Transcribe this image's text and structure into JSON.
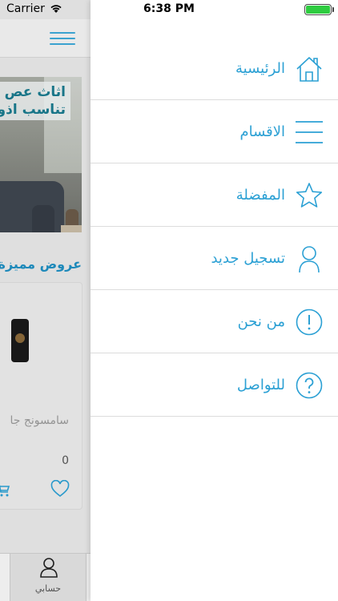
{
  "status_bar": {
    "carrier": "Carrier",
    "time": "6:38 PM",
    "wifi_icon": "wifi-icon",
    "battery_level": 1.0
  },
  "background_app": {
    "banner": {
      "line1": "اثاث عص",
      "line2": "تناسب اذو"
    },
    "section_title": "عروض مميزة",
    "product": {
      "name": "سامسونج جا",
      "price": "0"
    },
    "tab_bar": {
      "account_label": "حسابي"
    }
  },
  "drawer": {
    "accent_color": "#2ba0d4",
    "items": [
      {
        "label": "الرئيسية",
        "icon": "home-icon"
      },
      {
        "label": "الاقسام",
        "icon": "menu-lines-icon"
      },
      {
        "label": "المفضلة",
        "icon": "star-icon"
      },
      {
        "label": "تسجيل جديد",
        "icon": "user-icon"
      },
      {
        "label": "من نحن",
        "icon": "info-icon"
      },
      {
        "label": "للتواصل",
        "icon": "help-icon"
      }
    ]
  }
}
